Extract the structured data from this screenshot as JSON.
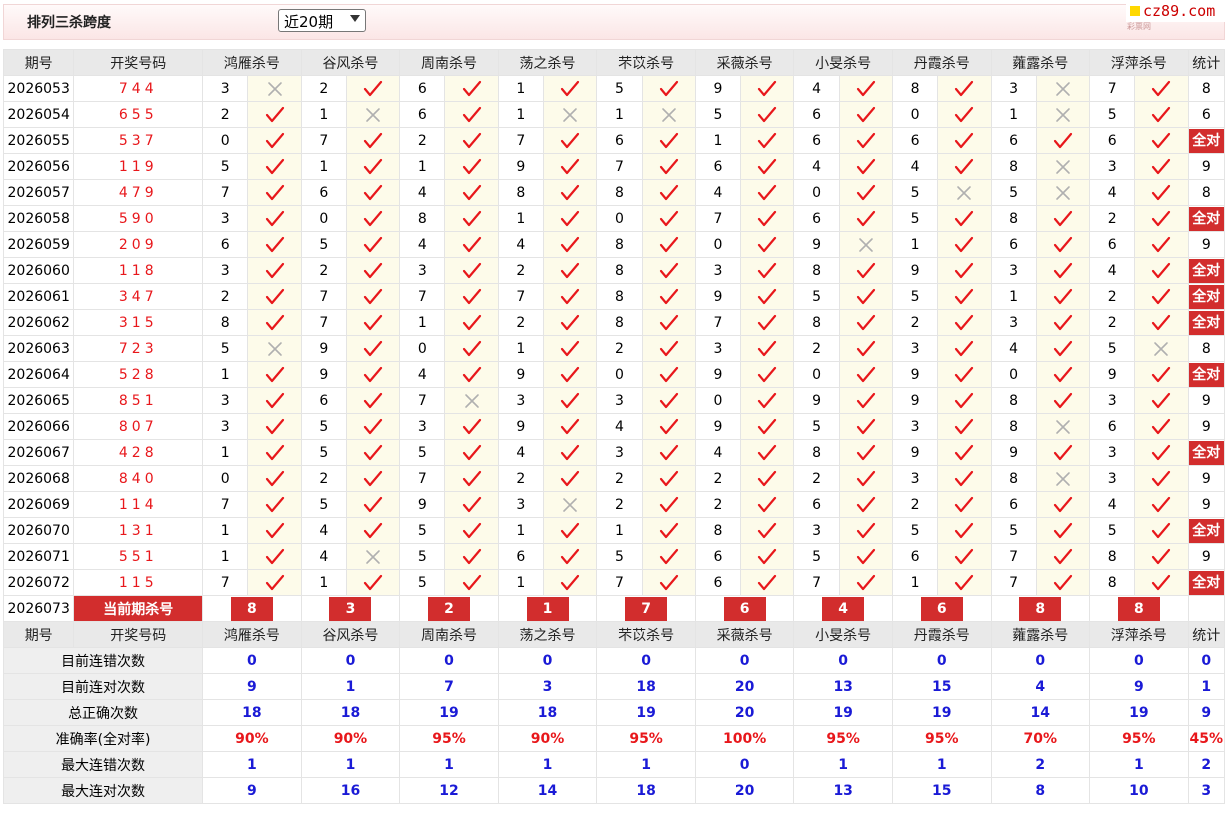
{
  "header": {
    "title": "排列三杀跨度",
    "period_selected": "近20期",
    "logo_text": "cz89.com",
    "logo_sub": "彩票网"
  },
  "columns": {
    "issue": "期号",
    "winning": "开奖号码",
    "experts": [
      "鸿雁杀号",
      "谷风杀号",
      "周南杀号",
      "荡之杀号",
      "芣苡杀号",
      "采薇杀号",
      "小旻杀号",
      "丹霞杀号",
      "蕹露杀号",
      "浮萍杀号"
    ],
    "stat": "统计"
  },
  "rows": [
    {
      "issue": "2026053",
      "win": "744",
      "kills": [
        3,
        2,
        6,
        1,
        5,
        9,
        4,
        8,
        3,
        7
      ],
      "ok": [
        0,
        1,
        1,
        1,
        1,
        1,
        1,
        1,
        0,
        1
      ],
      "stat": "8"
    },
    {
      "issue": "2026054",
      "win": "655",
      "kills": [
        2,
        1,
        6,
        1,
        1,
        5,
        6,
        0,
        1,
        5
      ],
      "ok": [
        1,
        0,
        1,
        0,
        0,
        1,
        1,
        1,
        0,
        1
      ],
      "stat": "6"
    },
    {
      "issue": "2026055",
      "win": "537",
      "kills": [
        0,
        7,
        2,
        7,
        6,
        1,
        6,
        6,
        6,
        6
      ],
      "ok": [
        1,
        1,
        1,
        1,
        1,
        1,
        1,
        1,
        1,
        1
      ],
      "stat": "全对"
    },
    {
      "issue": "2026056",
      "win": "119",
      "kills": [
        5,
        1,
        1,
        9,
        7,
        6,
        4,
        4,
        8,
        3
      ],
      "ok": [
        1,
        1,
        1,
        1,
        1,
        1,
        1,
        1,
        0,
        1
      ],
      "stat": "9"
    },
    {
      "issue": "2026057",
      "win": "479",
      "kills": [
        7,
        6,
        4,
        8,
        8,
        4,
        0,
        5,
        5,
        4
      ],
      "ok": [
        1,
        1,
        1,
        1,
        1,
        1,
        1,
        0,
        0,
        1
      ],
      "stat": "8"
    },
    {
      "issue": "2026058",
      "win": "590",
      "kills": [
        3,
        0,
        8,
        1,
        0,
        7,
        6,
        5,
        8,
        2
      ],
      "ok": [
        1,
        1,
        1,
        1,
        1,
        1,
        1,
        1,
        1,
        1
      ],
      "stat": "全对"
    },
    {
      "issue": "2026059",
      "win": "209",
      "kills": [
        6,
        5,
        4,
        4,
        8,
        0,
        9,
        1,
        6,
        6
      ],
      "ok": [
        1,
        1,
        1,
        1,
        1,
        1,
        0,
        1,
        1,
        1
      ],
      "stat": "9"
    },
    {
      "issue": "2026060",
      "win": "118",
      "kills": [
        3,
        2,
        3,
        2,
        8,
        3,
        8,
        9,
        3,
        4
      ],
      "ok": [
        1,
        1,
        1,
        1,
        1,
        1,
        1,
        1,
        1,
        1
      ],
      "stat": "全对"
    },
    {
      "issue": "2026061",
      "win": "347",
      "kills": [
        2,
        7,
        7,
        7,
        8,
        9,
        5,
        5,
        1,
        2
      ],
      "ok": [
        1,
        1,
        1,
        1,
        1,
        1,
        1,
        1,
        1,
        1
      ],
      "stat": "全对"
    },
    {
      "issue": "2026062",
      "win": "315",
      "kills": [
        8,
        7,
        1,
        2,
        8,
        7,
        8,
        2,
        3,
        2
      ],
      "ok": [
        1,
        1,
        1,
        1,
        1,
        1,
        1,
        1,
        1,
        1
      ],
      "stat": "全对"
    },
    {
      "issue": "2026063",
      "win": "723",
      "kills": [
        5,
        9,
        0,
        1,
        2,
        3,
        2,
        3,
        4,
        5
      ],
      "ok": [
        0,
        1,
        1,
        1,
        1,
        1,
        1,
        1,
        1,
        0
      ],
      "stat": "8"
    },
    {
      "issue": "2026064",
      "win": "528",
      "kills": [
        1,
        9,
        4,
        9,
        0,
        9,
        0,
        9,
        0,
        9
      ],
      "ok": [
        1,
        1,
        1,
        1,
        1,
        1,
        1,
        1,
        1,
        1
      ],
      "stat": "全对"
    },
    {
      "issue": "2026065",
      "win": "851",
      "kills": [
        3,
        6,
        7,
        3,
        3,
        0,
        9,
        9,
        8,
        3
      ],
      "ok": [
        1,
        1,
        0,
        1,
        1,
        1,
        1,
        1,
        1,
        1
      ],
      "stat": "9"
    },
    {
      "issue": "2026066",
      "win": "807",
      "kills": [
        3,
        5,
        3,
        9,
        4,
        9,
        5,
        3,
        8,
        6
      ],
      "ok": [
        1,
        1,
        1,
        1,
        1,
        1,
        1,
        1,
        0,
        1
      ],
      "stat": "9"
    },
    {
      "issue": "2026067",
      "win": "428",
      "kills": [
        1,
        5,
        5,
        4,
        3,
        4,
        8,
        9,
        9,
        3
      ],
      "ok": [
        1,
        1,
        1,
        1,
        1,
        1,
        1,
        1,
        1,
        1
      ],
      "stat": "全对"
    },
    {
      "issue": "2026068",
      "win": "840",
      "kills": [
        0,
        2,
        7,
        2,
        2,
        2,
        2,
        3,
        8,
        3
      ],
      "ok": [
        1,
        1,
        1,
        1,
        1,
        1,
        1,
        1,
        0,
        1
      ],
      "stat": "9"
    },
    {
      "issue": "2026069",
      "win": "114",
      "kills": [
        7,
        5,
        9,
        3,
        2,
        2,
        6,
        2,
        6,
        4
      ],
      "ok": [
        1,
        1,
        1,
        0,
        1,
        1,
        1,
        1,
        1,
        1
      ],
      "stat": "9"
    },
    {
      "issue": "2026070",
      "win": "131",
      "kills": [
        1,
        4,
        5,
        1,
        1,
        8,
        3,
        5,
        5,
        5
      ],
      "ok": [
        1,
        1,
        1,
        1,
        1,
        1,
        1,
        1,
        1,
        1
      ],
      "stat": "全对"
    },
    {
      "issue": "2026071",
      "win": "551",
      "kills": [
        1,
        4,
        5,
        6,
        5,
        6,
        5,
        6,
        7,
        8
      ],
      "ok": [
        1,
        0,
        1,
        1,
        1,
        1,
        1,
        1,
        1,
        1
      ],
      "stat": "9"
    },
    {
      "issue": "2026072",
      "win": "115",
      "kills": [
        7,
        1,
        5,
        1,
        7,
        6,
        7,
        1,
        7,
        8
      ],
      "ok": [
        1,
        1,
        1,
        1,
        1,
        1,
        1,
        1,
        1,
        1
      ],
      "stat": "全对"
    }
  ],
  "current": {
    "issue": "2026073",
    "label": "当前期杀号",
    "kills": [
      "8",
      "3",
      "2",
      "1",
      "7",
      "6",
      "4",
      "6",
      "8",
      "8"
    ]
  },
  "summary": [
    {
      "label": "目前连错次数",
      "color": "blue",
      "values": [
        "0",
        "0",
        "0",
        "0",
        "0",
        "0",
        "0",
        "0",
        "0",
        "0"
      ],
      "stat": "0"
    },
    {
      "label": "目前连对次数",
      "color": "blue",
      "values": [
        "9",
        "1",
        "7",
        "3",
        "18",
        "20",
        "13",
        "15",
        "4",
        "9"
      ],
      "stat": "1"
    },
    {
      "label": "总正确次数",
      "color": "blue",
      "values": [
        "18",
        "18",
        "19",
        "18",
        "19",
        "20",
        "19",
        "19",
        "14",
        "19"
      ],
      "stat": "9"
    },
    {
      "label": "准确率(全对率)",
      "color": "red",
      "values": [
        "90%",
        "90%",
        "95%",
        "90%",
        "95%",
        "100%",
        "95%",
        "95%",
        "70%",
        "95%"
      ],
      "stat": "45%"
    },
    {
      "label": "最大连错次数",
      "color": "blue",
      "values": [
        "1",
        "1",
        "1",
        "1",
        "1",
        "0",
        "1",
        "1",
        "2",
        "1"
      ],
      "stat": "2"
    },
    {
      "label": "最大连对次数",
      "color": "blue",
      "values": [
        "9",
        "16",
        "12",
        "14",
        "18",
        "20",
        "13",
        "15",
        "8",
        "10"
      ],
      "stat": "3"
    }
  ],
  "colors": {
    "accent": "#d22d2d",
    "win": "#e8171b",
    "blue": "#1a1ad6",
    "check": "#e8171b",
    "cross": "#b0b0b0"
  }
}
